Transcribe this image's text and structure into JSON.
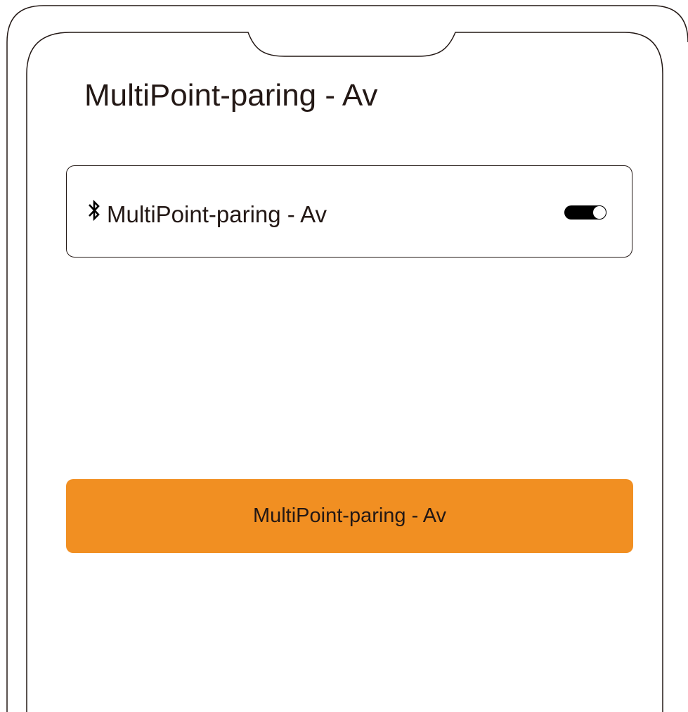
{
  "screen": {
    "title": "MultiPoint-paring - Av"
  },
  "bluetooth_card": {
    "icon": "bluetooth-icon",
    "label": "MultiPoint-paring - Av",
    "toggle_on": true
  },
  "action_button": {
    "label": "MultiPoint-paring - Av"
  },
  "colors": {
    "accent": "#f18f22",
    "text": "#231815",
    "toggle": "#000000"
  }
}
